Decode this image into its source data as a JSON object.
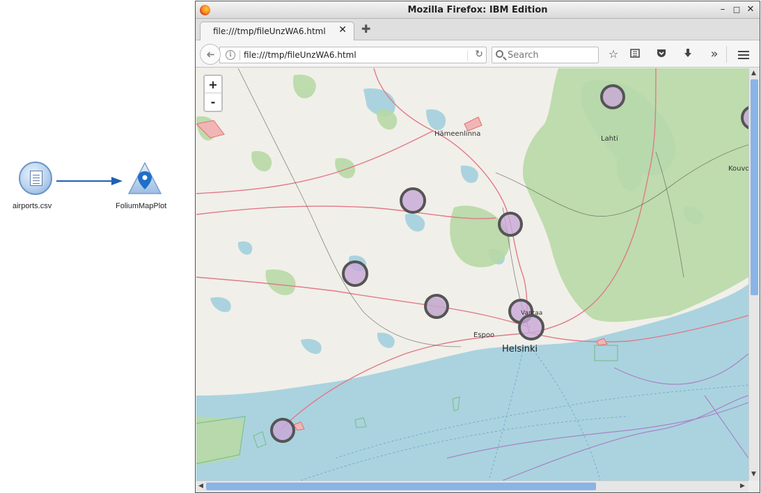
{
  "stream": {
    "source_node_label": "airports.csv",
    "plot_node_label": "FoliumMapPlot"
  },
  "window": {
    "title": "Mozilla Firefox: IBM Edition",
    "minimize": "–",
    "maximize": "□",
    "close": "✕"
  },
  "tab": {
    "title": "file:///tmp/fileUnzWA6.html",
    "close": "✕",
    "new_tab": "✚"
  },
  "nav": {
    "url": "file:///tmp/fileUnzWA6.html",
    "search_placeholder": "Search",
    "info": "i",
    "back": "➜",
    "reload": "↻",
    "more": "»"
  },
  "map": {
    "zoom_in": "+",
    "zoom_out": "-",
    "cities": {
      "hameenlinna": "Hämeenlinna",
      "lahti": "Lahti",
      "kouvola": "Kouvo",
      "espoo": "Espoo",
      "helsinki": "Helsinki",
      "vantaa": "Vantaa"
    },
    "marker_fill": "#c9a8d8",
    "marker_stroke": "#555555"
  },
  "colors": {
    "land": "#f1efe9",
    "water": "#aad3df",
    "forest": "#b8d9a6",
    "accent": "#1f5fb4"
  }
}
